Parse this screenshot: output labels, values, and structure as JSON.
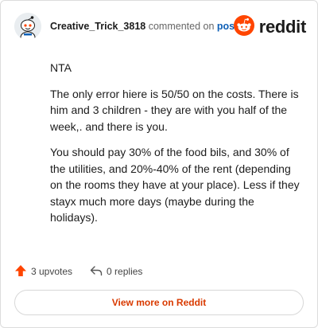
{
  "header": {
    "author": "Creative_Trick_3818",
    "action": "commented on",
    "post_link": "post",
    "brand": "reddit",
    "avatar_icon": "snoo-avatar-icon",
    "logo_icon": "reddit-logo-icon",
    "brand_color": "#ff4500"
  },
  "comment": {
    "paragraphs": [
      "NTA",
      "The only error hiere is 50/50 on the costs. There is him and 3 children - they are with you half of the week,. and there is you.",
      "You should pay 30% of the food bils, and 30% of the utilities, and 20%-40% of the rent (depending on the rooms they have at your place). Less if they stayx much more days (maybe during the holidays)."
    ]
  },
  "footer": {
    "upvotes": "3 upvotes",
    "replies": "0 replies",
    "upvote_icon": "upvote-arrow-icon",
    "reply_icon": "reply-arrow-icon",
    "upvote_color": "#ff4500"
  },
  "actions": {
    "view_more": "View more on Reddit"
  }
}
